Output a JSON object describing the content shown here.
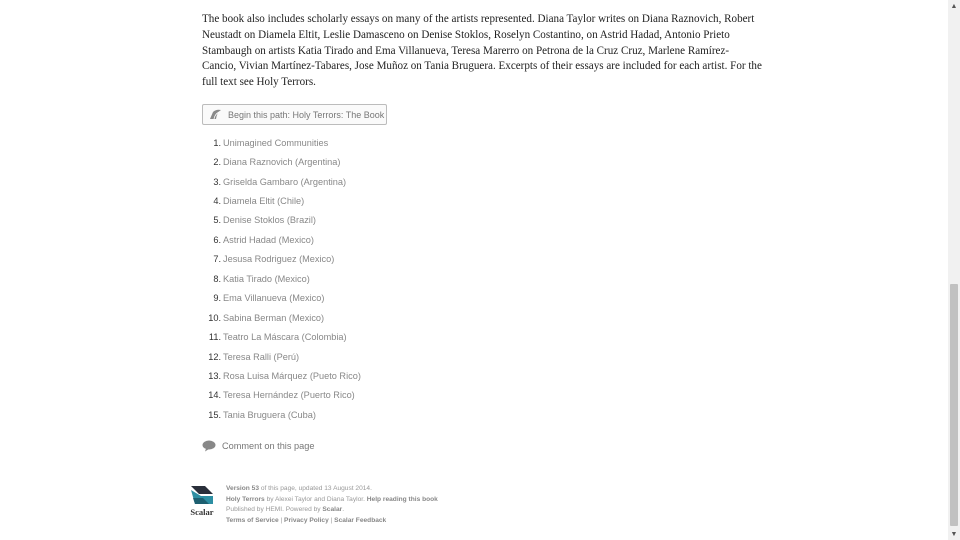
{
  "intro": {
    "text": "The book also includes scholarly essays on many of the artists represented.  Diana Taylor writes on Diana Raznovich, Robert Neustadt on Diamela Eltit, Leslie Damasceno on Denise Stoklos, Roselyn Costantino, on Astrid Hadad, Antonio Prieto Stambaugh on artists Katia Tirado and Ema Villanueva, Teresa Marerro on Petrona de la Cruz Cruz, Marlene Ramírez-Cancio, Vivian Martínez-Tabares, Jose Muñoz on Tania Bruguera.  Excerpts of their essays are included for each artist. For the full text see Holy Terrors."
  },
  "path_button": {
    "label": "Begin this path: Holy Terrors: The Book",
    "icon": "path-icon"
  },
  "path_items": [
    {
      "num": "1.",
      "label": "Unimagined Communities"
    },
    {
      "num": "2.",
      "label": "Diana Raznovich (Argentina)"
    },
    {
      "num": "3.",
      "label": "Griselda Gambaro (Argentina)"
    },
    {
      "num": "4.",
      "label": "Diamela Eltit (Chile)"
    },
    {
      "num": "5.",
      "label": "Denise Stoklos (Brazil)"
    },
    {
      "num": "6.",
      "label": "Astrid Hadad (Mexico)"
    },
    {
      "num": "7.",
      "label": "Jesusa Rodriguez (Mexico)"
    },
    {
      "num": "8.",
      "label": "Katia Tirado (Mexico)"
    },
    {
      "num": "9.",
      "label": "Ema Villanueva (Mexico)"
    },
    {
      "num": "10.",
      "label": "Sabina Berman (Mexico)"
    },
    {
      "num": "11.",
      "label": "Teatro La Máscara (Colombia)"
    },
    {
      "num": "12.",
      "label": "Teresa Ralli (Perú)"
    },
    {
      "num": "13.",
      "label": "Rosa Luisa Márquez (Pueto Rico)"
    },
    {
      "num": "14.",
      "label": "Teresa Hernández (Puerto Rico)"
    },
    {
      "num": "15.",
      "label": "Tania Bruguera (Cuba)"
    }
  ],
  "comment": {
    "label": "Comment on this page",
    "icon": "comment-bubble-icon"
  },
  "footer": {
    "logo_text": "Scalar",
    "version_label": "Version 53",
    "version_rest": "of this page, updated 13 August 2014.",
    "book_title": "Holy Terrors",
    "book_by": "by Alexei Taylor and Diana Taylor.",
    "help_link": "Help reading this book",
    "published": "Published by HEMI. Powered by",
    "powered_link": "Scalar",
    "period": ".",
    "terms_link": "Terms of Service",
    "privacy_link": "Privacy Policy",
    "feedback_link": "Scalar Feedback",
    "separator": " | "
  },
  "colors": {
    "list_link": "#888888",
    "button_border": "#bcbcbc",
    "logo_dark": "#2a2f3a",
    "logo_teal": "#2d8fa3"
  }
}
